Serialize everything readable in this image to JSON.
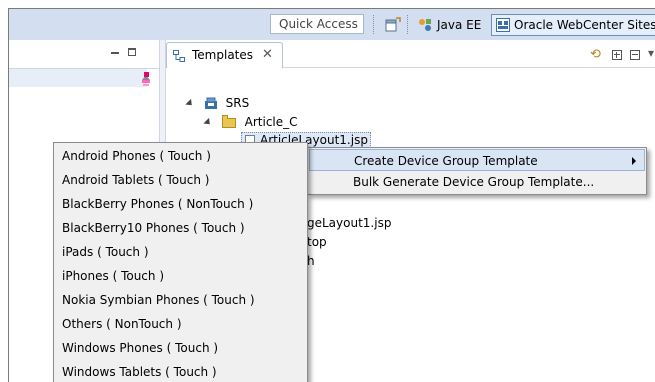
{
  "toolbar": {
    "quick_access": "Quick Access",
    "perspectives": [
      {
        "label": "Java EE",
        "icon": "java-ee-perspective-icon"
      },
      {
        "label": "Oracle WebCenter Sites",
        "icon": "webcenter-sites-perspective-icon",
        "active": true
      }
    ]
  },
  "templates_view": {
    "tab_title": "Templates",
    "tree": {
      "project": "SRS",
      "folder": "Article_C",
      "selected_file_partial": "ArticleLayout1.jsp",
      "partial_rows": [
        "geLayout1.jsp",
        "top",
        "h"
      ]
    }
  },
  "context_menu": {
    "items": [
      {
        "label": "Create Device Group Template",
        "has_submenu": true,
        "highlighted": true
      },
      {
        "label": "Bulk Generate Device Group Template...",
        "has_submenu": false,
        "highlighted": false
      }
    ]
  },
  "device_submenu": {
    "items": [
      "Android Phones ( Touch )",
      "Android Tablets ( Touch )",
      "BlackBerry Phones ( NonTouch )",
      "BlackBerry10 Phones ( Touch )",
      "iPads ( Touch )",
      "iPhones ( Touch )",
      "Nokia Symbian Phones ( Touch )",
      "Others ( NonTouch )",
      "Windows Phones ( Touch )",
      "Windows Tablets ( Touch )"
    ]
  },
  "colors": {
    "toolbar_bg": "#d3dff0",
    "menu_bg": "#f0f0f0",
    "menu_highlight": "#d9e5f5"
  }
}
